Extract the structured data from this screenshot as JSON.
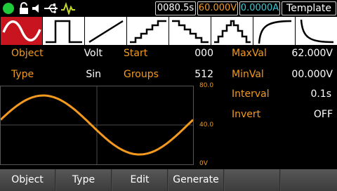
{
  "status": {
    "time": "0080.5s",
    "voltage": "60.000V",
    "current": "0.0000A",
    "mode": "Template",
    "icons": [
      "status-led-icon",
      "lock-icon",
      "speaker-icon",
      "usb-icon",
      "pulse-icon"
    ]
  },
  "waveforms": [
    {
      "name": "sine",
      "selected": true
    },
    {
      "name": "square",
      "selected": false
    },
    {
      "name": "ramp",
      "selected": false
    },
    {
      "name": "stair-up",
      "selected": false
    },
    {
      "name": "stair-down",
      "selected": false
    },
    {
      "name": "stair-up-down",
      "selected": false
    },
    {
      "name": "exp-rise",
      "selected": false
    },
    {
      "name": "exp-fall",
      "selected": false
    }
  ],
  "params": {
    "object_label": "Object",
    "object_value": "Volt",
    "type_label": "Type",
    "type_value": "Sin",
    "start_label": "Start",
    "start_value": "000",
    "groups_label": "Groups",
    "groups_value": "512",
    "maxval_label": "MaxVal",
    "maxval_value": "62.000V",
    "minval_label": "MinVal",
    "minval_value": "00.000V",
    "interval_label": "Interval",
    "interval_value": "0.1s",
    "invert_label": "Invert",
    "invert_value": "OFF"
  },
  "preview": {
    "y_max": "80.0",
    "y_mid": "40.0",
    "y_min": "0V",
    "curve_color": "#f39a1e"
  },
  "softkeys": [
    "Object",
    "Type",
    "Edit",
    "Generate",
    "",
    ""
  ],
  "colors": {
    "accent": "#f39a1e",
    "selected_tile": "#c8141e",
    "current": "#3ec8d8",
    "led": "#1ecb3a"
  }
}
